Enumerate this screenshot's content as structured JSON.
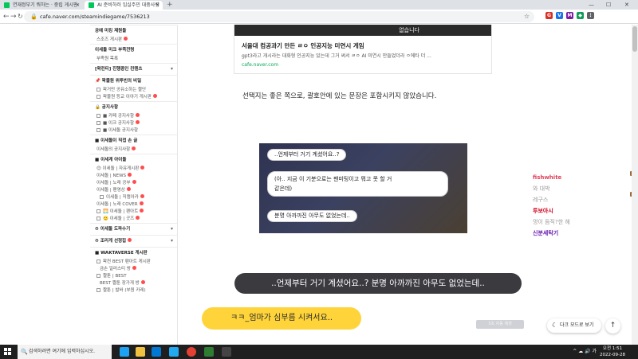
{
  "browser": {
    "tabs": [
      {
        "title": "연재정부기 뭐하는 · 중립 게시판",
        "active": false
      },
      {
        "title": "AI 준비하러 임실주민 대중사령",
        "active": true
      }
    ],
    "new_tab": "+",
    "url": "cafe.naver.com/steamindiegame/7536213",
    "back": "←",
    "forward": "→",
    "reload": "↻",
    "lock": "🔒",
    "bookmark": "☆",
    "window_controls": {
      "minimize": "—",
      "maximize": "☐",
      "close": "✕"
    },
    "extensions": [
      {
        "label": "G",
        "color": "#d93025"
      },
      {
        "label": "V",
        "color": "#1a73e8"
      },
      {
        "label": "M",
        "color": "#7b1fa2"
      },
      {
        "label": "◆",
        "color": "#0f9d58"
      },
      {
        "label": "⋮",
        "color": "#5f6368"
      }
    ]
  },
  "sidebar": {
    "rows": [
      {
        "type": "head",
        "label": "공예 미킹 재원들"
      },
      {
        "type": "item",
        "label": "스조즈 게시판",
        "badge": true
      },
      {
        "type": "head",
        "label": "이세돌 미크 부족전령"
      },
      {
        "type": "item",
        "label": "부족원 목록"
      },
      {
        "type": "head",
        "label": "[왁컨티] 진행중인 컨텐츠",
        "chevron": "▾"
      },
      {
        "type": "head",
        "label": "📌 왁물원 위투빈의 비밀"
      },
      {
        "type": "item",
        "label": "왁거만 공유소하는 짤단",
        "box": true
      },
      {
        "type": "item",
        "label": "왁물원 등교 이야기 게시판",
        "box": true,
        "badge": true
      },
      {
        "type": "head",
        "label": "🔒 공지사항"
      },
      {
        "type": "item",
        "label": "■ 카페 공지사항",
        "box": true,
        "badge": true
      },
      {
        "type": "item",
        "label": "■ 이크 공지사항",
        "box": true,
        "badge": true
      },
      {
        "type": "item",
        "label": "■ 이세돌 공지사항",
        "box": true
      },
      {
        "type": "head",
        "label": "■ 이세돌이 직접 손 글"
      },
      {
        "type": "item",
        "label": "이세돌의 공지사항",
        "badge": true
      },
      {
        "type": "head",
        "label": "■ 이세계 아이돌"
      },
      {
        "type": "item",
        "label": "😊 이세돌 | 자유게시판",
        "badge": true
      },
      {
        "type": "item",
        "label": "이세돌 | NEWS",
        "badge": true
      },
      {
        "type": "item",
        "label": "이세돌 | 노래 공부",
        "badge": true
      },
      {
        "type": "item",
        "label": "이세돌 | 팬영상",
        "badge": true
      },
      {
        "type": "item",
        "label": "이세돌 | 직캠아카",
        "box": true,
        "badge": true,
        "sub": true
      },
      {
        "type": "item",
        "label": "이세돌 | 노래 COVER",
        "badge": true
      },
      {
        "type": "item",
        "label": "🌅 이세돌 | 팬아트",
        "box": true,
        "badge": true
      },
      {
        "type": "item",
        "label": "🙂 이세돌 | 굿즈",
        "box": true,
        "badge": true
      },
      {
        "type": "head",
        "label": "♻ 이세돌 도파수기",
        "chevron": "▾"
      },
      {
        "type": "head",
        "label": "♻ 조리게 선정집",
        "badge": true,
        "chevron": "▾"
      },
      {
        "type": "head",
        "label": "■ WAKTAVERSE 게시판"
      },
      {
        "type": "item",
        "label": "왁컨 BEST 팬아트 게시판",
        "box": true
      },
      {
        "type": "item",
        "label": "금손 일러스티 방",
        "badge": true,
        "sub": true
      },
      {
        "type": "item",
        "label": "짤툰 | BEST",
        "box": true
      },
      {
        "type": "item",
        "label": "BEST 짤툰 장가게 방",
        "badge": true,
        "sub": true
      },
      {
        "type": "item",
        "label": "짤툰 | 발바 (부원 카레)",
        "box": true
      }
    ]
  },
  "og_card": {
    "strip_text": "없습니다",
    "title": "서울대 컴공과기 만든 ㄹㅇ 인공지능 미연시 게임",
    "description": "gpt3라고 개시라는 대화형 인공지능 있는데 그거 써서 ㄹㅇ AI 미연시 만들었더라 ㅇ에타 더 ...",
    "url": "cafe.naver.com"
  },
  "paragraph": "선택지는 좋은 쪽으로, 괄호안에 있는 문장은 포함시키지 않았습니다.",
  "game_bubbles": [
    "..언제부터 거기 계셨어요..?",
    "(아.. 지금 이 기분으로는 팬미팅이고 뭐고 못 할 거",
    "같은데)",
    "분명 아까까진 아무도 없었는데.."
  ],
  "chat": [
    {
      "text": "fishwhite",
      "color": "#e0405a",
      "bold": true
    },
    {
      "text": "와 대박",
      "color": "#999999"
    },
    {
      "text": "레구스",
      "color": "#999999"
    },
    {
      "text": "루보아시",
      "color": "#d0021b",
      "bold": true
    },
    {
      "text": "멍이 듬직?한 헤",
      "color": "#999999"
    },
    {
      "text": "신분세탁기",
      "color": "#6a1bb0",
      "bold": true
    }
  ],
  "subtitles": {
    "dark": "..언제부터 거기 계셨어요..? 분명 아까까진 아무도 없었는데..",
    "yellow": "ㅋㅋ_엄마가 심부름 시켜서요.."
  },
  "hint": "5초 자동 재생",
  "dark_mode": {
    "icon": "☾",
    "label": "다크 모드로 보기"
  },
  "to_top": "↑",
  "taskbar": {
    "search_placeholder": "검색하려면 여기에 입력하십시오.",
    "search_icon": "🔍",
    "apps": [
      {
        "name": "edge",
        "color": "#1da1f2"
      },
      {
        "name": "explorer",
        "color": "#f0c040"
      },
      {
        "name": "store",
        "color": "#0078d4"
      },
      {
        "name": "vscode",
        "color": "#23a9f2"
      },
      {
        "name": "chrome",
        "color": "#e34133"
      },
      {
        "name": "app-green",
        "color": "#2e7d32"
      },
      {
        "name": "app-dark",
        "color": "#444444"
      }
    ],
    "tray_icons": "^ ☁ 🔊 가",
    "time": "오전 1:51",
    "date": "2022-09-28"
  }
}
